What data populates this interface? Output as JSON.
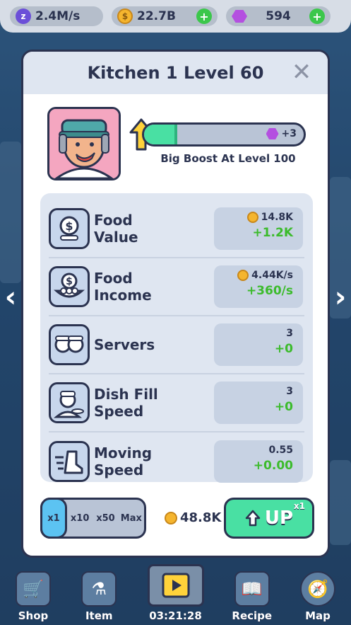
{
  "topbar": {
    "rate": "2.4M/s",
    "coins": "22.7B",
    "gems": "594"
  },
  "modal": {
    "title": "Kitchen 1 Level 60",
    "progress_fraction": 0.21,
    "progress_reward": "+3",
    "boost_text": "Big Boost At Level 100"
  },
  "stats": [
    {
      "label_1": "Food",
      "label_2": "Value",
      "value": "14.8K",
      "increase": "+1.2K",
      "has_coin": true,
      "icon": "money-bag-icon"
    },
    {
      "label_1": "Food",
      "label_2": "Income",
      "value": "4.44K/s",
      "increase": "+360/s",
      "has_coin": true,
      "icon": "food-income-icon"
    },
    {
      "label_1": "Servers",
      "label_2": "",
      "value": "3",
      "increase": "+0",
      "has_coin": false,
      "icon": "servers-icon"
    },
    {
      "label_1": "Dish Fill",
      "label_2": "Speed",
      "value": "3",
      "increase": "+0",
      "has_coin": false,
      "icon": "chef-icon"
    },
    {
      "label_1": "Moving",
      "label_2": "Speed",
      "value": "0.55",
      "increase": "+0.00",
      "has_coin": false,
      "icon": "speed-boot-icon"
    }
  ],
  "multiplier": {
    "options": [
      "x1",
      "x10",
      "x50",
      "Max"
    ],
    "selected": "x1"
  },
  "upgrade": {
    "cost": "48.8K",
    "label": "UP",
    "multiplier_badge": "x1"
  },
  "nav": {
    "shop": "Shop",
    "item": "Item",
    "timer": "03:21:28",
    "recipe": "Recipe",
    "map": "Map"
  }
}
